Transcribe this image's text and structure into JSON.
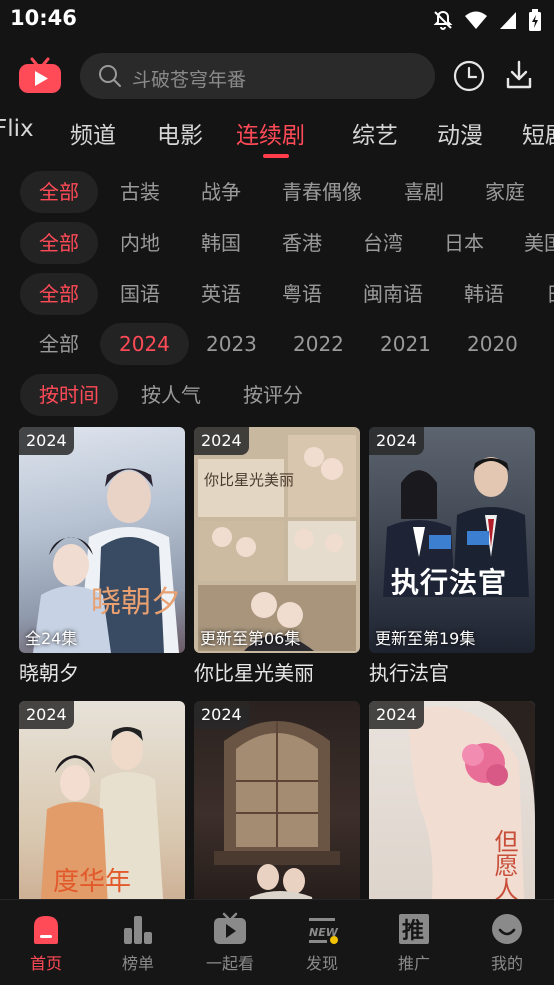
{
  "status_bar": {
    "time": "10:46"
  },
  "search": {
    "placeholder": "斗破苍穹年番"
  },
  "top_tabs": [
    "Flix",
    "频道",
    "电影",
    "连续剧",
    "综艺",
    "动漫",
    "短剧"
  ],
  "filters": {
    "genre": [
      "全部",
      "古装",
      "战争",
      "青春偶像",
      "喜剧",
      "家庭"
    ],
    "region": [
      "全部",
      "内地",
      "韩国",
      "香港",
      "台湾",
      "日本",
      "美国"
    ],
    "language": [
      "全部",
      "国语",
      "英语",
      "粤语",
      "闽南语",
      "韩语",
      "日语"
    ],
    "year": [
      "全部",
      "2024",
      "2023",
      "2022",
      "2021",
      "2020"
    ],
    "sort": [
      "按时间",
      "按人气",
      "按评分"
    ]
  },
  "cards": [
    {
      "year": "2024",
      "episodes": "全24集",
      "title": "晓朝夕",
      "poster_text": "晓朝夕"
    },
    {
      "year": "2024",
      "episodes": "更新至第06集",
      "title": "你比星光美丽",
      "poster_text": "你比星光美丽"
    },
    {
      "year": "2024",
      "episodes": "更新至第19集",
      "title": "执行法官",
      "poster_text": "执行法官"
    },
    {
      "year": "2024",
      "episodes": "",
      "title": "",
      "poster_text": "度华年"
    },
    {
      "year": "2024",
      "episodes": "",
      "title": "",
      "poster_text": ""
    },
    {
      "year": "2024",
      "episodes": "",
      "title": "",
      "poster_text": "但愿人长"
    }
  ],
  "bottom_nav": [
    "首页",
    "榜单",
    "一起看",
    "发现",
    "推广",
    "我的"
  ],
  "colors": {
    "accent": "#ff4a57",
    "background": "#141414"
  }
}
